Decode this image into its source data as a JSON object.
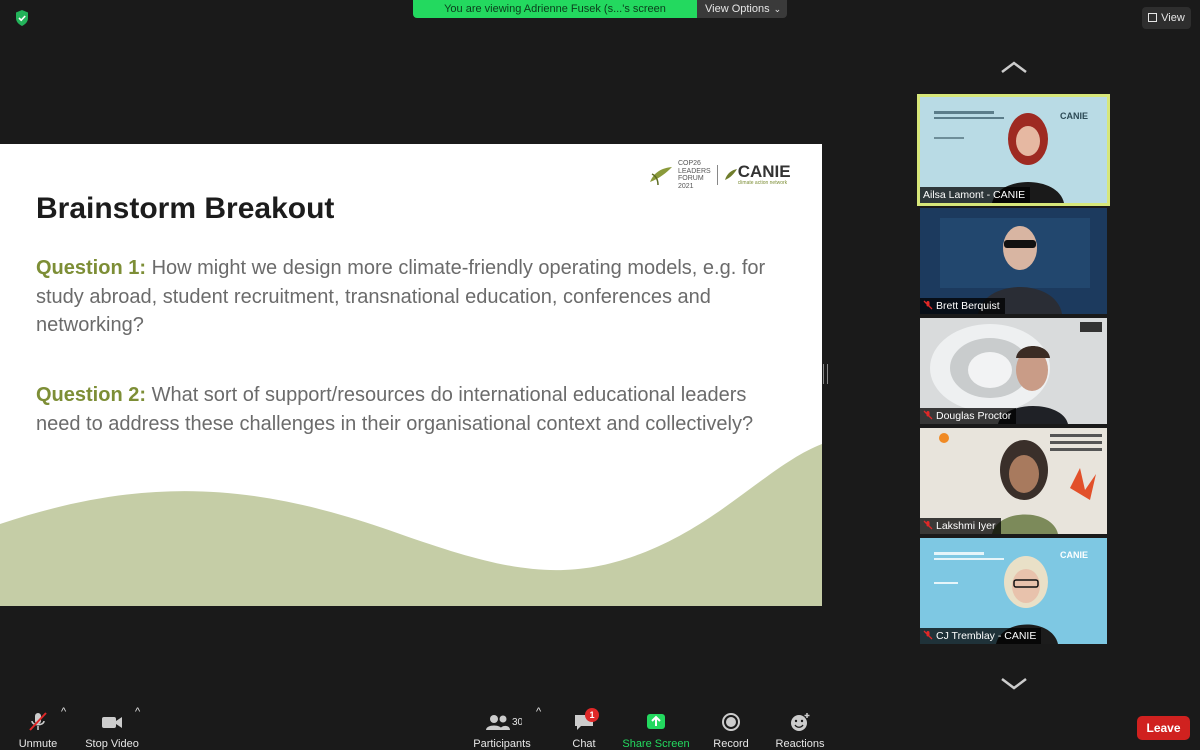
{
  "header": {
    "banner_text": "You are viewing Adrienne Fusek (s...'s screen",
    "view_options_label": "View Options",
    "view_button_label": "View",
    "security_icon": "shield-check-icon"
  },
  "slide": {
    "title": "Brainstorm Breakout",
    "question1_label": "Question 1:",
    "question1_text": " How might we design more climate-friendly operating models, e.g. for study abroad, student recruitment, transnational education, conferences and networking?",
    "question2_label": "Question 2:",
    "question2_text": " What sort of support/resources do international educational leaders need to address these challenges in their organisational context and collectively?",
    "logo_cop": [
      "COP26",
      "LEADERS",
      "FORUM",
      "2021"
    ],
    "logo_canie": "CANIE",
    "logo_canie_sub": "climate action network",
    "accent_color": "#7d8e36",
    "wave_color": "#c5cda6"
  },
  "participants": [
    {
      "name": "Ailsa Lamont - CANIE",
      "muted": false,
      "active": true,
      "bg": "#b9dbe5"
    },
    {
      "name": "Brett Berquist",
      "muted": true,
      "active": false,
      "bg": "#1c3a5e"
    },
    {
      "name": "Douglas Proctor",
      "muted": true,
      "active": false,
      "bg": "#d9dbdc"
    },
    {
      "name": "Lakshmi Iyer",
      "muted": true,
      "active": false,
      "bg": "#e8e4dc"
    },
    {
      "name": "CJ Tremblay - CANIE",
      "muted": true,
      "active": false,
      "bg": "#7ec8e3"
    }
  ],
  "toolbar": {
    "unmute": "Unmute",
    "stop_video": "Stop Video",
    "participants": "Participants",
    "participants_count": "30",
    "chat": "Chat",
    "chat_badge": "1",
    "share_screen": "Share Screen",
    "record": "Record",
    "reactions": "Reactions",
    "leave": "Leave",
    "share_color": "#23d95f",
    "leave_color": "#d0211f"
  }
}
